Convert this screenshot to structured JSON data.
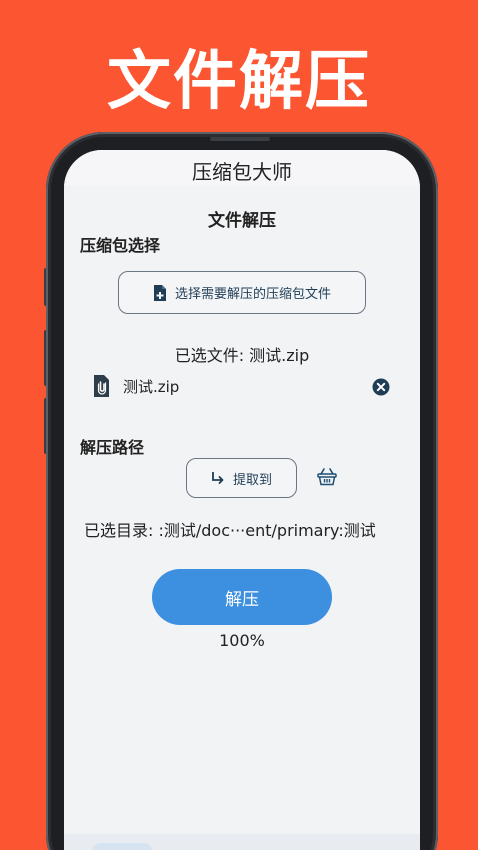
{
  "banner": {
    "title": "文件解压"
  },
  "app": {
    "title": "压缩包大师"
  },
  "page": {
    "heading": "文件解压"
  },
  "archive": {
    "section_label": "压缩包选择",
    "select_button_label": "选择需要解压的压缩包文件",
    "selected_text": "已选文件: 测试.zip",
    "file_name": "测试.zip"
  },
  "extract_path": {
    "section_label": "解压路径",
    "extract_button_label": "提取到",
    "selected_dir_text": "已选目录: :测试/doc···ent/primary:测试"
  },
  "action": {
    "decompress_label": "解压",
    "progress_text": "100%"
  },
  "colors": {
    "banner_bg": "#fc5531",
    "primary_button": "#3d8fe0",
    "icon_dark": "#1f3d55"
  }
}
